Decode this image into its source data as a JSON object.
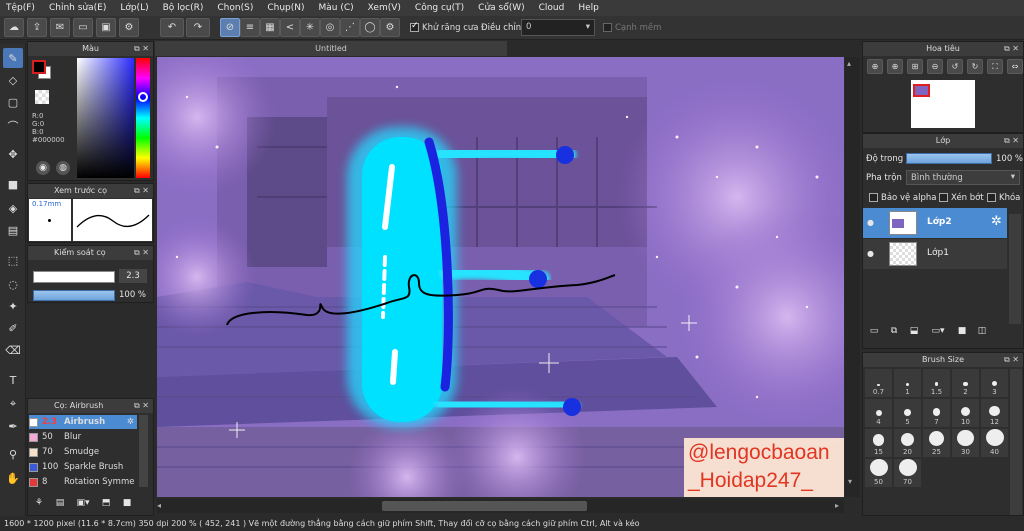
{
  "menu": [
    "Tệp(F)",
    "Chỉnh sửa(E)",
    "Lớp(L)",
    "Bộ lọc(R)",
    "Chọn(S)",
    "Chụp(N)",
    "Màu (C)",
    "Xem(V)",
    "Công cụ(T)",
    "Cửa sổ(W)",
    "Cloud",
    "Help"
  ],
  "toolbar": {
    "antialias_label": "Khử răng cưa",
    "adjust_label": "Điều chỉnh",
    "adjust_value": "0",
    "smooth_label": "Cạnh mềm"
  },
  "color_panel": {
    "title": "Màu",
    "r": "R:0",
    "g": "G:0",
    "b": "B:0",
    "hex": "#000000",
    "primary": "#000000",
    "secondary": "#ffffff"
  },
  "preview_panel": {
    "title": "Xem trước cọ",
    "size": "0.17mm"
  },
  "control_panel": {
    "title": "Kiểm soát cọ",
    "size_value": "2.3",
    "opacity_value": "100 %"
  },
  "brush_panel": {
    "title": "Cọ: Airbrush",
    "brushes": [
      {
        "size": "2.3",
        "name": "Airbrush",
        "color": "#ffffff",
        "selected": true
      },
      {
        "size": "50",
        "name": "Blur",
        "color": "#f4a9d6",
        "selected": false
      },
      {
        "size": "70",
        "name": "Smudge",
        "color": "#f6e0c8",
        "selected": false
      },
      {
        "size": "100",
        "name": "Sparkle Brush",
        "color": "#3b5bd6",
        "selected": false
      },
      {
        "size": "8",
        "name": "Rotation Symme",
        "color": "#e23a3a",
        "selected": false
      }
    ]
  },
  "document": {
    "title": "Untitled"
  },
  "watermark": {
    "line1": "@lengocbaoan",
    "line2": "_Hoidap247_"
  },
  "navigator": {
    "title": "Hoa tiêu"
  },
  "layer_panel": {
    "title": "Lớp",
    "opacity_label": "Độ trong",
    "opacity_value": "100 %",
    "blend_label": "Pha trộn",
    "blend_value": "Bình thường",
    "protect_alpha": "Bảo vệ alpha",
    "clip": "Xén bớt",
    "lock": "Khóa",
    "layers": [
      {
        "name": "Lớp2",
        "selected": true
      },
      {
        "name": "Lớp1",
        "selected": false
      }
    ]
  },
  "brush_size_panel": {
    "title": "Brush Size",
    "sizes": [
      "0.7",
      "1",
      "1.5",
      "2",
      "3",
      "4",
      "5",
      "7",
      "10",
      "12",
      "15",
      "20",
      "25",
      "30",
      "40",
      "50",
      "70"
    ]
  },
  "status": {
    "dims": "1600 * 1200 pixel",
    "cm": "(11.6 * 8.7cm)",
    "dpi": "350 dpi",
    "zoom": "200 %",
    "coords": "( 452, 241 )",
    "hint": "Vẽ một đường thẳng bằng cách giữ phím Shift, Thay đổi cỡ cọ bằng cách giữ phím Ctrl, Alt và kéo"
  }
}
